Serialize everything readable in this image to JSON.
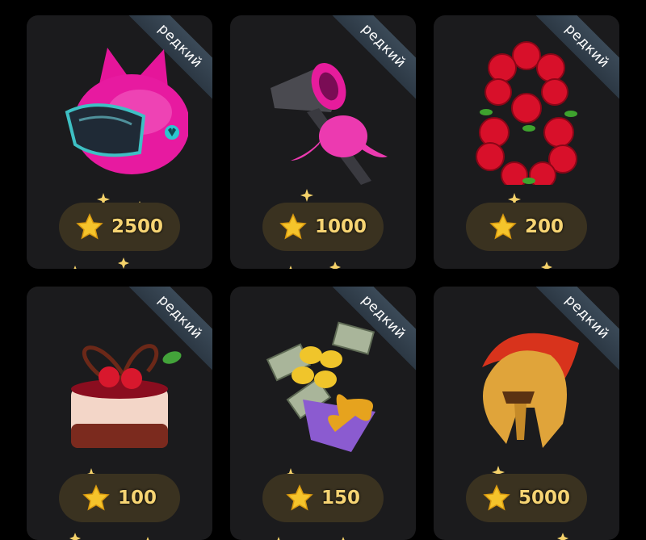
{
  "gifts": [
    {
      "id": "helmet-cat",
      "badge": "редкий",
      "price": "2500",
      "icon": "pink-cat-ear-helmet"
    },
    {
      "id": "hair-dryer",
      "badge": "редкий",
      "price": "1000",
      "icon": "hair-dryer-with-bow"
    },
    {
      "id": "roses-8",
      "badge": "редкий",
      "price": "200",
      "icon": "rose-number-eight"
    },
    {
      "id": "cake",
      "badge": "редкий",
      "price": "100",
      "icon": "heart-cherry-cake"
    },
    {
      "id": "bouquet",
      "badge": "редкий",
      "price": "150",
      "icon": "money-lemon-bouquet"
    },
    {
      "id": "spartan",
      "badge": "редкий",
      "price": "5000",
      "icon": "spartan-helmet"
    }
  ],
  "colors": {
    "card": "#1b1b1d",
    "ribbon": "#34424f",
    "price_pill": "#3a3220",
    "price_text": "#f6d473",
    "star": "#f5c42b"
  }
}
